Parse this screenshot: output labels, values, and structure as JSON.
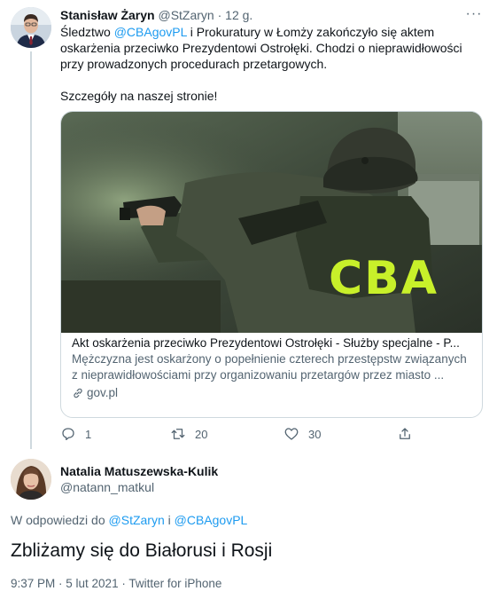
{
  "tweet": {
    "author_name": "Stanisław Żaryn",
    "author_handle": "@StZaryn",
    "separator": "·",
    "time": "12 g.",
    "more_glyph": "···",
    "body_line1_pre": "Śledztwo ",
    "body_line1_mention": "@CBAgovPL",
    "body_line1_post": " i Prokuratury w Łomży zakończyło się aktem",
    "body_line2": "oskarżenia przeciwko Prezydentowi Ostrołęki. Chodzi o nieprawidłowości",
    "body_line3": "przy prowadzonych procedurach przetargowych.",
    "body_line4": "Szczegóły na naszej stronie!",
    "card": {
      "image_text": "CBA",
      "title": "Akt oskarżenia przeciwko Prezydentowi Ostrołęki - Służby specjalne - P...",
      "description_line1": "Mężczyzna jest oskarżony o popełnienie czterech przestępstw związanych",
      "description_line2": "z nieprawidłowościami przy organizowaniu przetargów przez miasto ...",
      "domain": "gov.pl"
    },
    "actions": {
      "reply_count": "1",
      "retweet_count": "20",
      "like_count": "30"
    }
  },
  "reply": {
    "author_name": "Natalia Matuszewska-Kulik",
    "author_handle": "@natann_matkul",
    "reply_prefix": "W odpowiedzi do ",
    "reply_mention1": "@StZaryn",
    "reply_joiner": " i ",
    "reply_mention2": "@CBAgovPL",
    "text": "Zbliżamy się do Białorusi i Rosji",
    "meta": "9:37 PM · 5 lut 2021 · Twitter for iPhone"
  },
  "colors": {
    "link": "#1d9bf0",
    "secondary_text": "#536471",
    "border": "#cfd9de",
    "cba_lettering": "#c8f02a"
  }
}
